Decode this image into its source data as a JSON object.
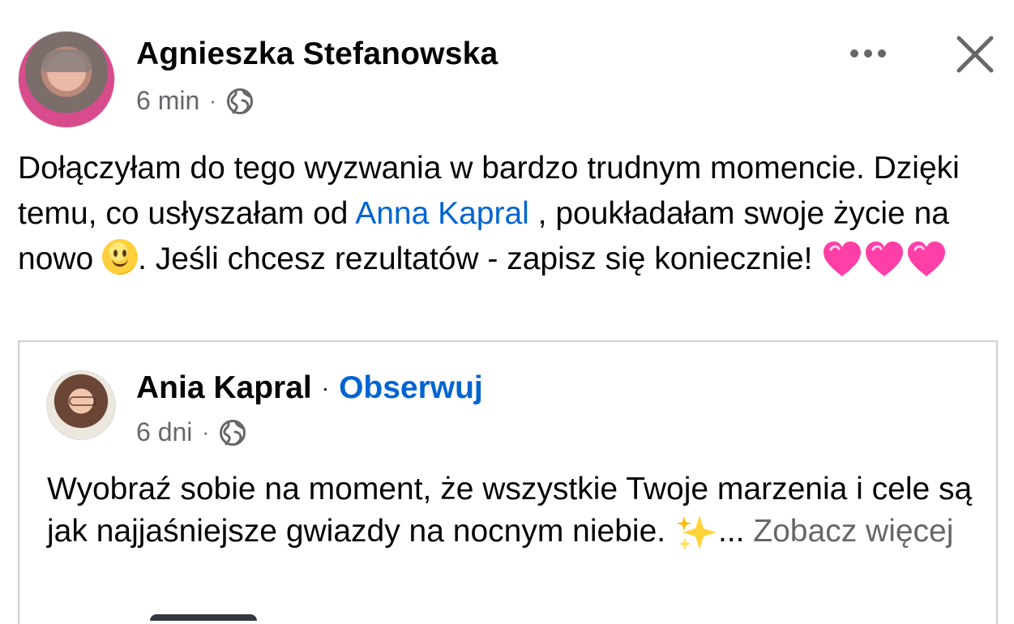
{
  "post": {
    "author": "Agnieszka Stefanowska",
    "time": "6 min",
    "separator": "·",
    "text_part1": "Dołączyłam do tego wyzwania w bardzo trudnym momencie. Dzięki temu, co usłyszałam od ",
    "mention": "Anna Kapral",
    "text_part2": " , poukładałam swoje życie na nowo ",
    "text_part3": ". Jeśli chcesz rezultatów - zapisz się koniecznie! "
  },
  "shared": {
    "author": "Ania Kapral",
    "separator": "·",
    "follow": "Obserwuj",
    "time": "6 dni",
    "text": "Wyobraź sobie na moment, że wszystkie Twoje marzenia i cele są jak najjaśniejsze gwiazdy na nocnym niebie. ",
    "ellipsis": "...",
    "see_more": "Zobacz więcej"
  },
  "icons": {
    "globe": "globe-icon",
    "more": "more-horizontal-icon",
    "close": "close-icon",
    "smile": "slightly-smiling-face-emoji",
    "heart": "pink-heart-emoji",
    "sparkles": "sparkles-emoji"
  },
  "colors": {
    "link": "#0064d1",
    "secondary_text": "#65676b",
    "border": "#ced0d4",
    "heart": "#ff3fa8"
  }
}
